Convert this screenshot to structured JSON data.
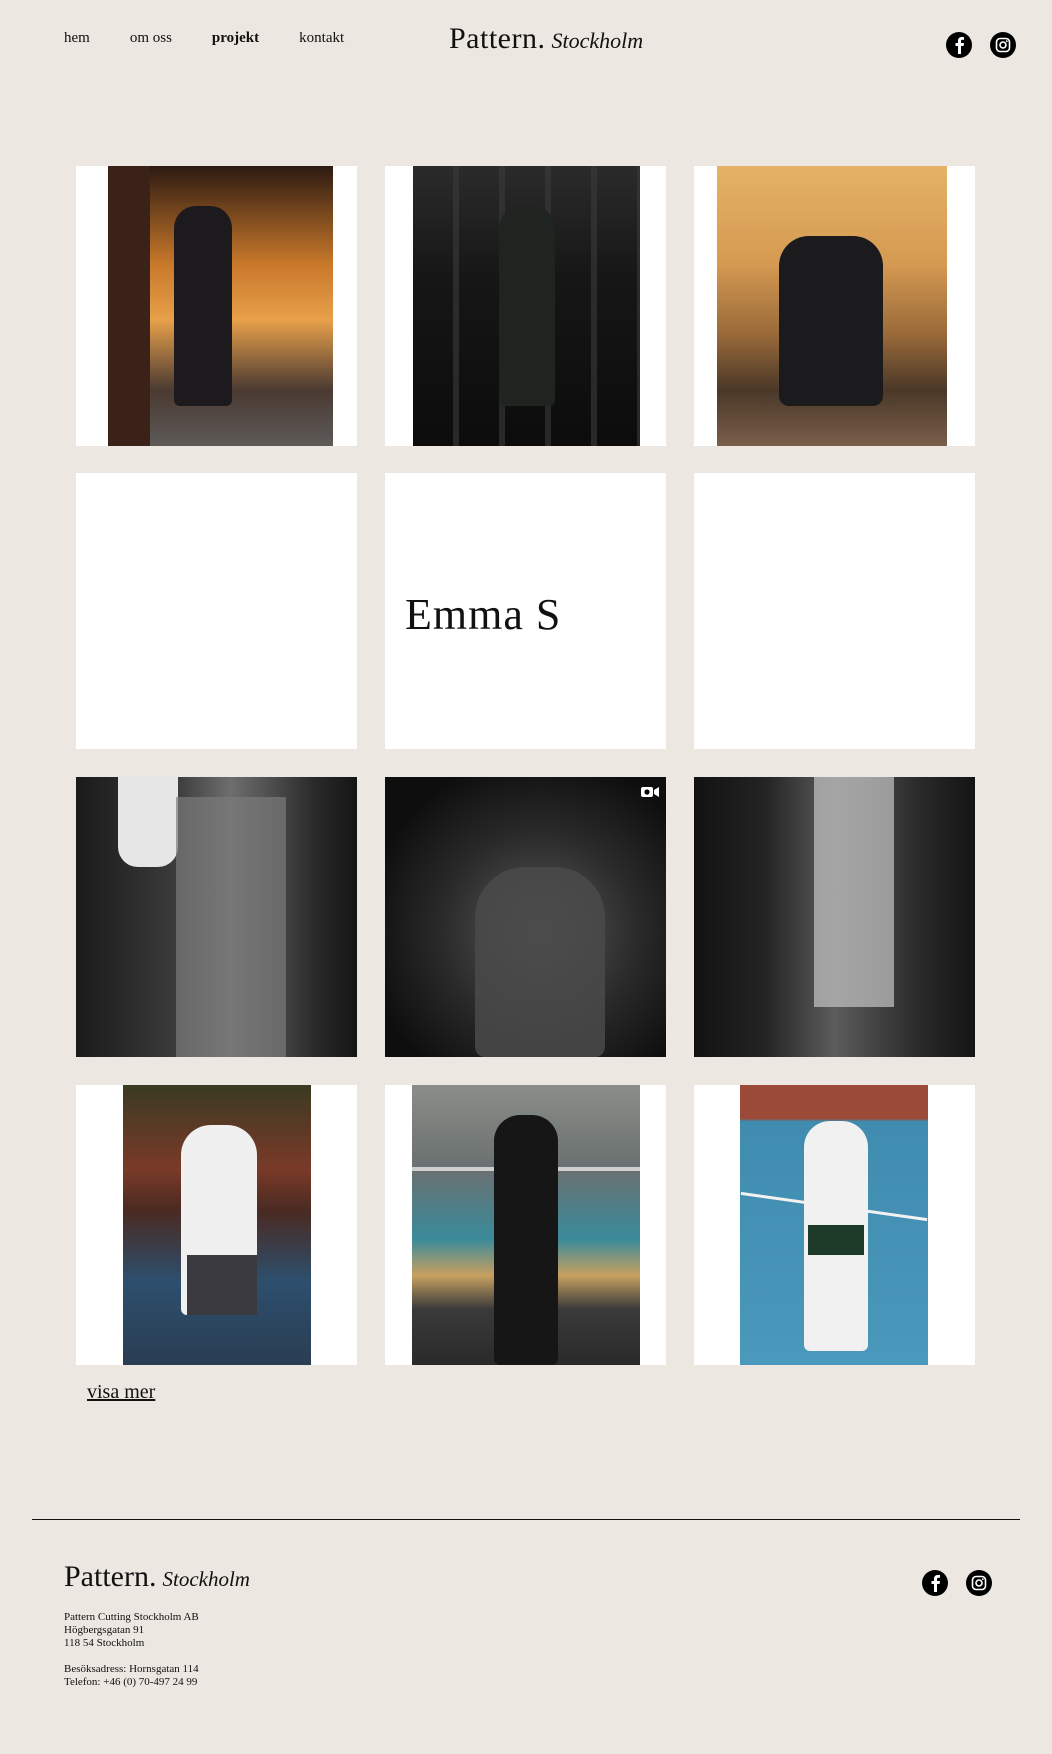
{
  "nav": {
    "items": [
      {
        "label": "hem",
        "active": false
      },
      {
        "label": "om oss",
        "active": false
      },
      {
        "label": "projekt",
        "active": true
      },
      {
        "label": "kontakt",
        "active": false
      }
    ]
  },
  "logo": {
    "main": "Pattern.",
    "script": "Stockholm"
  },
  "social": {
    "icons": [
      "facebook-icon",
      "instagram-icon"
    ]
  },
  "tiles": {
    "brand_tile_text": "Emma S"
  },
  "visa_mer": "visa mer",
  "footer": {
    "logo": {
      "main": "Pattern.",
      "script": "Stockholm"
    },
    "company": "Pattern Cutting Stockholm AB",
    "street": "Högbergsgatan 91",
    "city": "118 54 Stockholm",
    "visit": "Besöksadress: Hornsgatan 114",
    "phone": "Telefon: +46 (0) 70-497 24 99"
  },
  "colors": {
    "background": "#ece7e1",
    "text": "#111111",
    "tile": "#ffffff"
  }
}
